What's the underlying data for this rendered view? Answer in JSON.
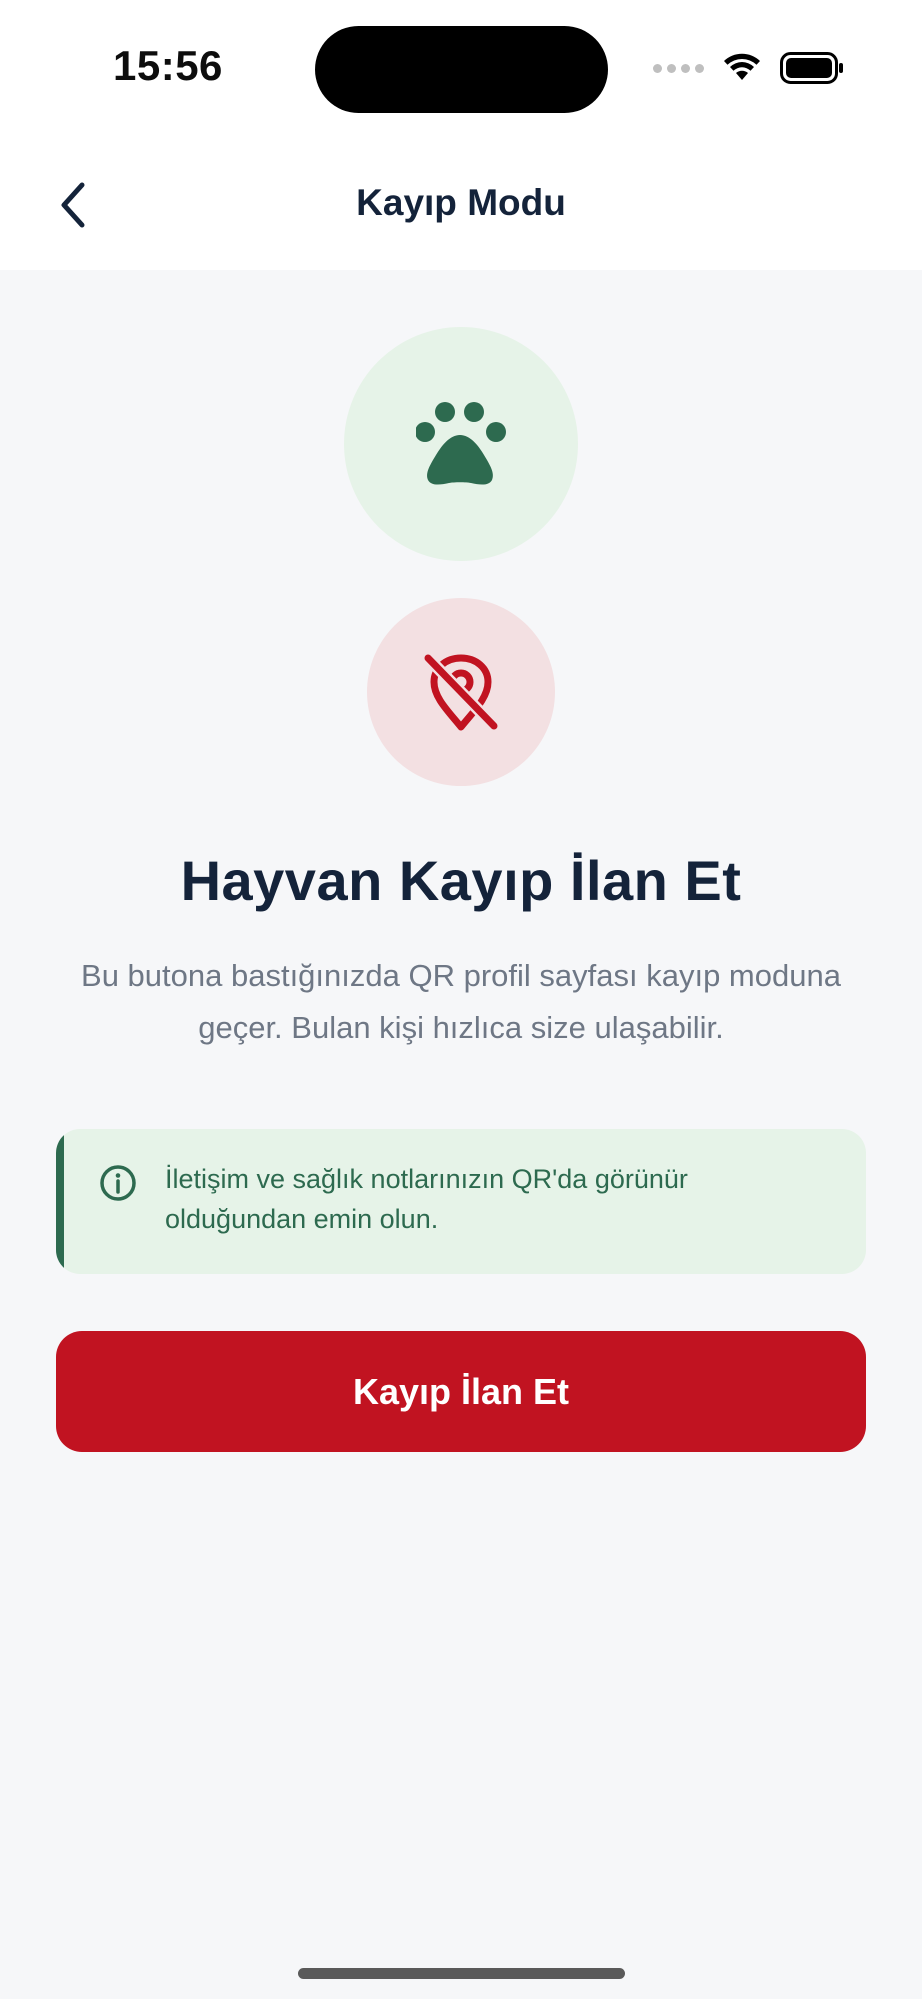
{
  "status_bar": {
    "time": "15:56"
  },
  "nav": {
    "title": "Kayıp Modu",
    "back_icon": "chevron-left-icon"
  },
  "hero": {
    "paw_icon": "paw-icon",
    "lost_icon": "location-off-icon"
  },
  "content": {
    "headline": "Hayvan Kayıp İlan Et",
    "description": "Bu butona bastığınızda QR profil sayfası kayıp moduna geçer. Bulan kişi hızlıca size ulaşabilir.",
    "info_text": "İletişim ve sağlık notlarınızın QR'da görünür olduğundan emin olun.",
    "button_label": "Kayıp İlan Et"
  },
  "colors": {
    "primary_green": "#2d6a4f",
    "light_green": "#e6f3e8",
    "danger_red": "#c11321",
    "light_red": "#f3e0e2",
    "background": "#f6f7f9",
    "text_dark": "#14233a",
    "text_muted": "#6e7785"
  }
}
